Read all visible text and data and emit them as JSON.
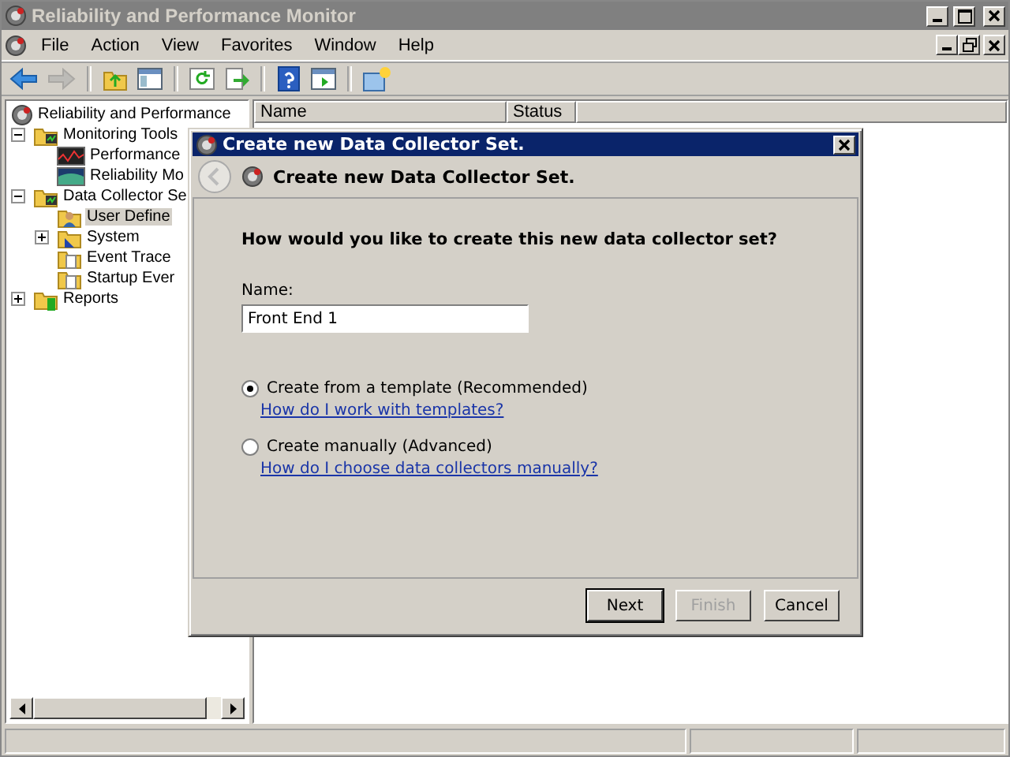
{
  "window": {
    "title": "Reliability and Performance Monitor"
  },
  "menu": [
    "File",
    "Action",
    "View",
    "Favorites",
    "Window",
    "Help"
  ],
  "toolbar": [
    {
      "kind": "back",
      "disabled": false
    },
    {
      "kind": "forward",
      "disabled": true
    },
    {
      "kind": "separator"
    },
    {
      "kind": "folder-up",
      "disabled": false
    },
    {
      "kind": "panel",
      "disabled": false
    },
    {
      "kind": "separator"
    },
    {
      "kind": "refresh",
      "disabled": false
    },
    {
      "kind": "export",
      "disabled": false
    },
    {
      "kind": "separator"
    },
    {
      "kind": "help",
      "disabled": false
    },
    {
      "kind": "panel-play",
      "disabled": false
    },
    {
      "kind": "separator"
    },
    {
      "kind": "new-window",
      "disabled": false
    }
  ],
  "tree": [
    {
      "label": "Reliability and Performance",
      "kind": "gear",
      "selected": false,
      "children": [
        {
          "label": "Monitoring Tools",
          "kind": "folder",
          "expanded": true,
          "selected": false,
          "children": [
            {
              "label": "Performance",
              "kind": "chart",
              "selected": false
            },
            {
              "label": "Reliability Mo",
              "kind": "graph",
              "selected": false
            }
          ]
        },
        {
          "label": "Data Collector Se",
          "kind": "folder",
          "expanded": true,
          "selected": false,
          "children": [
            {
              "label": "User Define",
              "kind": "user-folder",
              "selected": true
            },
            {
              "label": "System",
              "kind": "system-folder",
              "expanded": false,
              "selected": false
            },
            {
              "label": "Event Trace",
              "kind": "doc-folder",
              "selected": false
            },
            {
              "label": "Startup Ever",
              "kind": "doc-folder",
              "selected": false
            }
          ]
        },
        {
          "label": "Reports",
          "kind": "reports-folder",
          "expanded": false,
          "selected": false
        }
      ]
    }
  ],
  "list": {
    "columns": [
      "Name",
      "Status"
    ]
  },
  "dialog": {
    "title": "Create new Data Collector Set.",
    "header": "Create new Data Collector Set.",
    "back_disabled": true,
    "question": "How would you like to create this new data collector set?",
    "name_label": "Name:",
    "name_value": "Front End 1",
    "options": [
      {
        "label": "Create from a template (Recommended)",
        "link": "How do I work with templates?",
        "selected": true
      },
      {
        "label": "Create manually (Advanced)",
        "link": "How do I choose data collectors manually?",
        "selected": false
      }
    ],
    "buttons": [
      {
        "label": "Next",
        "default": true,
        "disabled": false
      },
      {
        "label": "Finish",
        "default": false,
        "disabled": true
      },
      {
        "label": "Cancel",
        "default": false,
        "disabled": false
      }
    ]
  }
}
